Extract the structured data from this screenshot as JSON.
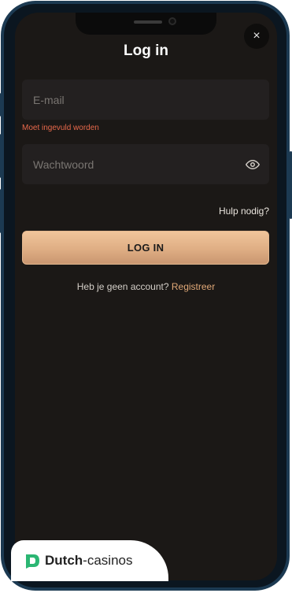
{
  "modal": {
    "title": "Log in",
    "close_icon": "×"
  },
  "form": {
    "email_placeholder": "E-mail",
    "email_value": "",
    "email_error": "Moet ingevuld worden",
    "password_placeholder": "Wachtwoord",
    "password_value": "",
    "help_link": "Hulp nodig?",
    "submit_label": "LOG IN"
  },
  "footer": {
    "prompt": "Heb je geen account?",
    "register_link": "Registreer"
  },
  "watermark": {
    "brand_bold": "Dutch",
    "brand_rest": "-casinos"
  },
  "colors": {
    "background": "#1b1816",
    "accent": "#e0a877",
    "error": "#e8694b",
    "button_gradient_top": "#f0c59b",
    "button_gradient_bottom": "#c99670"
  }
}
